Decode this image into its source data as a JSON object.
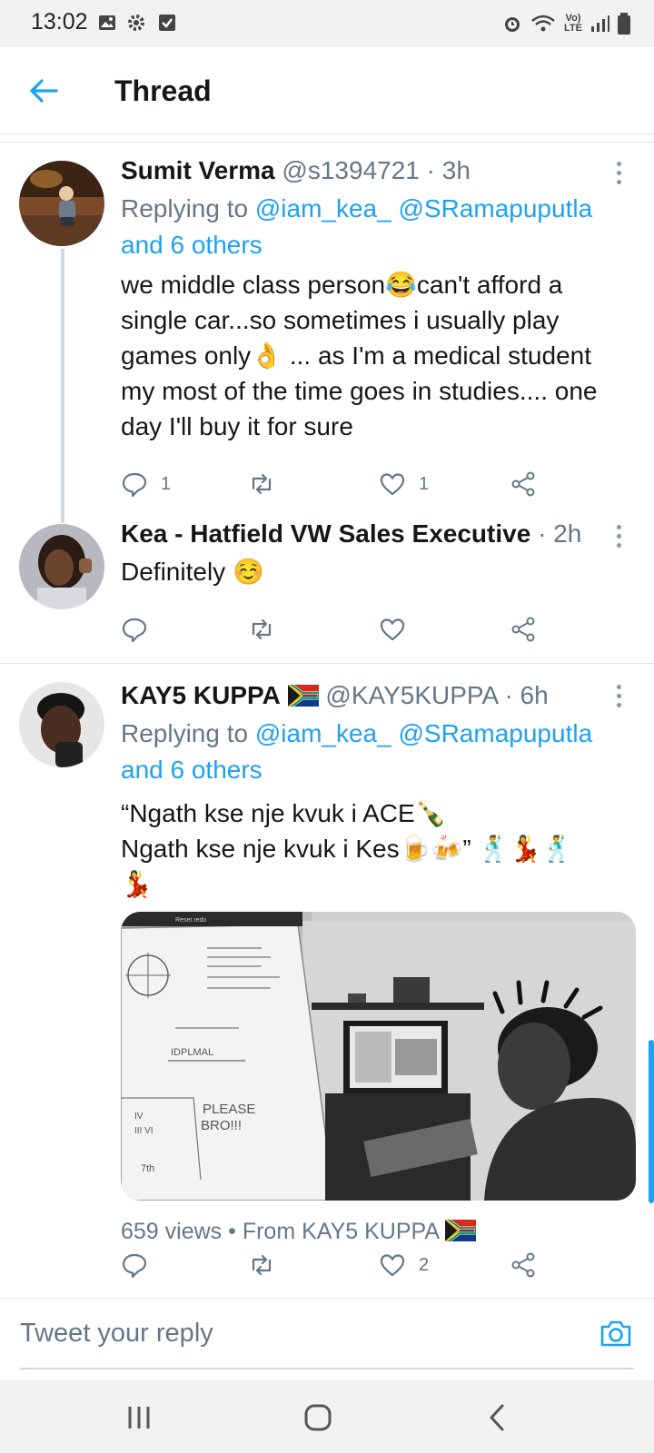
{
  "status_bar": {
    "time": "13:02",
    "network": "Vo) LTE"
  },
  "header": {
    "title": "Thread"
  },
  "tweets": [
    {
      "name": "Sumit Verma",
      "handle": "@s1394721",
      "time": "· 3h",
      "replying_prefix": "Replying to ",
      "replying_to": "@iam_kea_ @SRamapuputla",
      "replying_others": "and 6 others",
      "text": "we middle class person😂can't afford a single car...so sometimes i usually play games only👌 ... as I'm a medical student my most of the time goes in studies.... one day I'll buy it for sure",
      "replies": "1",
      "retweets": "",
      "likes": "1"
    },
    {
      "name": "Kea - Hatfield VW Sales Executive",
      "time": "· 2h",
      "text": "Definitely ☺️",
      "replies": "",
      "retweets": "",
      "likes": ""
    },
    {
      "name": "KAY5 KUPPA",
      "handle": "@KAY5KUPPA",
      "time": "· 6h",
      "replying_prefix": "Replying to ",
      "replying_to": "@iam_kea_ @SRamapuputla",
      "replying_others": "and 6 others",
      "text": "“Ngath kse nje kvuk i ACE🍾\nNgath kse nje kvuk i Kes🍺🍻” 🕺💃🕺\n💃",
      "media": {
        "whiteboard_lines": [
          "IDPLMAL",
          "PLEASE",
          "BRO!!!",
          "7th",
          "IV",
          "III VI"
        ],
        "toolbar": "Reset  redo"
      },
      "views": "659 views",
      "from": "• From KAY5 KUPPA",
      "replies": "",
      "retweets": "",
      "likes": "2"
    }
  ],
  "reply_bar": {
    "placeholder": "Tweet your reply"
  },
  "colors": {
    "accent": "#1da1f2",
    "secondary_text": "#657786",
    "border": "#e1e8ed"
  },
  "icons": [
    "back-arrow-icon",
    "more-icon",
    "reply-icon",
    "retweet-icon",
    "like-icon",
    "share-icon",
    "camera-icon",
    "recents-icon",
    "home-icon",
    "back-icon"
  ]
}
